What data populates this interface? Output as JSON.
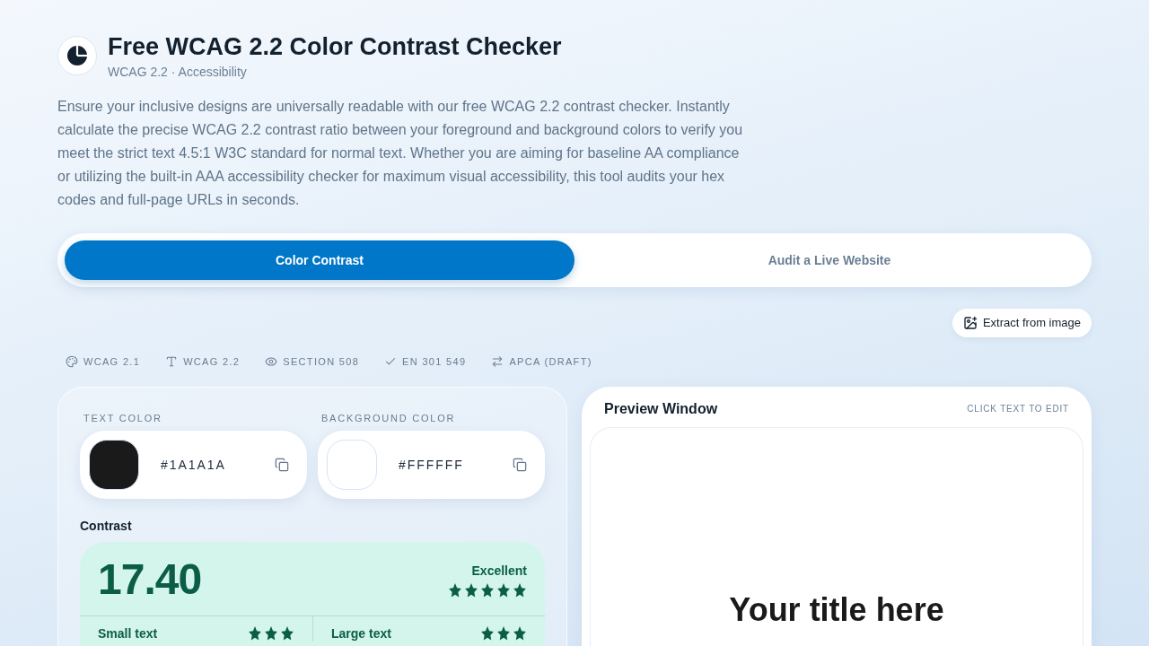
{
  "header": {
    "title": "Free WCAG 2.2 Color Contrast Checker",
    "subtitle": "WCAG 2.2 · Accessibility",
    "description": "Ensure your inclusive designs are universally readable with our free WCAG 2.2 contrast checker. Instantly calculate the precise WCAG 2.2 contrast ratio between your foreground and background colors to verify you meet the strict text 4.5:1 W3C standard for normal text. Whether you are aiming for baseline AA compliance or utilizing the built-in AAA accessibility checker for maximum visual accessibility, this tool audits your hex codes and full-page URLs in seconds."
  },
  "tabs": [
    {
      "label": "Color Contrast",
      "selected": true
    },
    {
      "label": "Audit a Live Website",
      "selected": false
    }
  ],
  "extract_button": {
    "label": "Extract from image"
  },
  "standards": [
    {
      "label": "WCAG 2.1"
    },
    {
      "label": "WCAG 2.2"
    },
    {
      "label": "SECTION 508"
    },
    {
      "label": "EN 301 549"
    },
    {
      "label": "APCA (DRAFT)"
    }
  ],
  "inputs": [
    {
      "label": "TEXT COLOR",
      "value": "#1A1A1A"
    },
    {
      "label": "BACKGROUND COLOR",
      "value": "#FFFFFF"
    }
  ],
  "contrast": {
    "label": "Contrast",
    "ratio": "17.40",
    "rating": "Excellent",
    "stars": 5,
    "levels": [
      {
        "label": "Small text",
        "stars": 3
      },
      {
        "label": "Large text",
        "stars": 3
      }
    ]
  },
  "preview": {
    "title": "Preview Window",
    "hint": "CLICK TEXT TO EDIT",
    "heading": "Your title here"
  }
}
